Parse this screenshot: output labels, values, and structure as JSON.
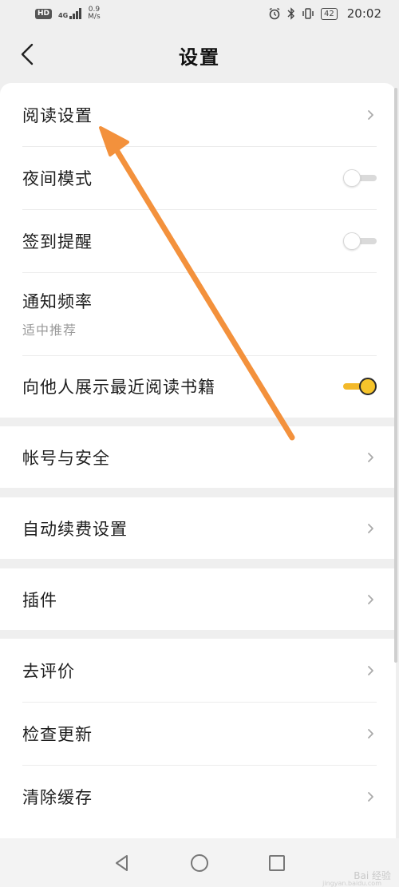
{
  "status_bar": {
    "hd": "HD",
    "network": "4G",
    "speed_value": "0.9",
    "speed_unit": "M/s",
    "battery": "42",
    "time": "20:02"
  },
  "header": {
    "title": "设置"
  },
  "sections": [
    {
      "items": [
        {
          "label": "阅读设置",
          "type": "link"
        },
        {
          "label": "夜间模式",
          "type": "toggle",
          "on": false
        },
        {
          "label": "签到提醒",
          "type": "toggle",
          "on": false
        },
        {
          "label": "通知频率",
          "subtitle": "适中推荐",
          "type": "info"
        },
        {
          "label": "向他人展示最近阅读书籍",
          "type": "toggle",
          "on": true
        }
      ]
    },
    {
      "items": [
        {
          "label": "帐号与安全",
          "type": "link"
        }
      ]
    },
    {
      "items": [
        {
          "label": "自动续费设置",
          "type": "link"
        }
      ]
    },
    {
      "items": [
        {
          "label": "插件",
          "type": "link"
        }
      ]
    },
    {
      "items": [
        {
          "label": "去评价",
          "type": "link"
        },
        {
          "label": "检查更新",
          "type": "link"
        },
        {
          "label": "清除缓存",
          "type": "link"
        }
      ]
    }
  ],
  "watermark": {
    "text": "Bai 经验",
    "sub": "jingyan.baidu.com"
  },
  "colors": {
    "toggle_on": "#f6c42b",
    "annotation_arrow": "#f3913c",
    "background": "#efefef"
  }
}
